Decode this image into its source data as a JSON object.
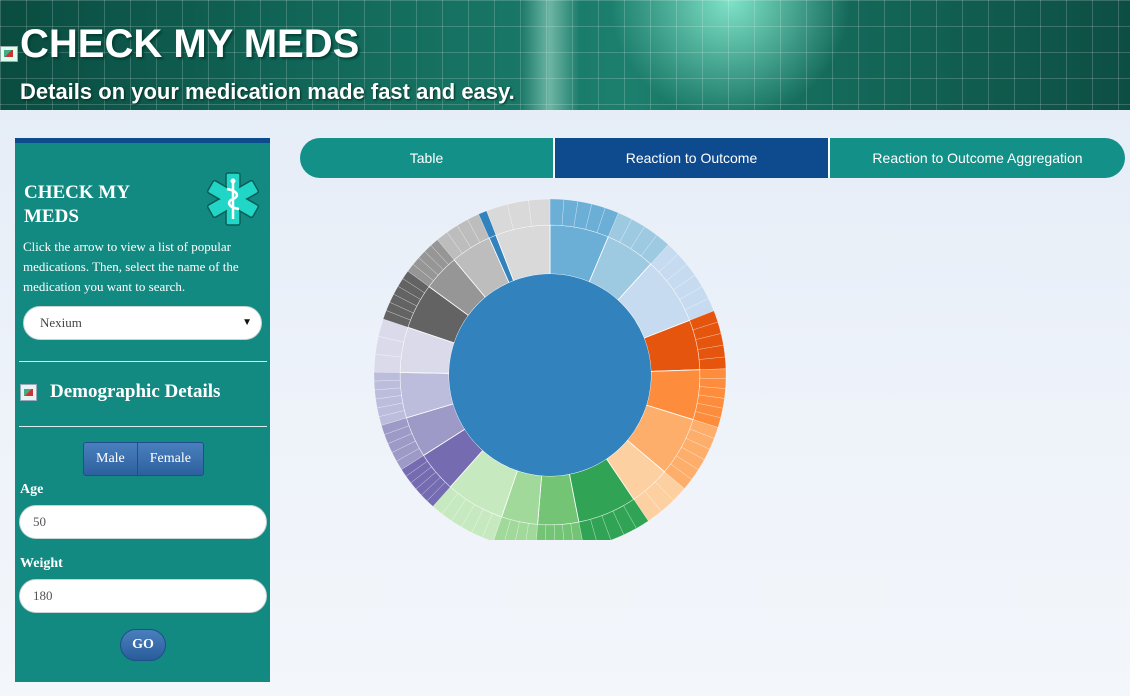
{
  "header": {
    "title": "CHECK MY MEDS",
    "tagline": "Details on your medication made fast and easy."
  },
  "sidebar": {
    "brand_title": "CHECK MY MEDS",
    "intro": "Click the arrow to view a list of popular medications. Then, select the name of the medication you want to search.",
    "medication_select": {
      "value": "Nexium"
    },
    "demographics_title": "Demographic Details",
    "gender_buttons": [
      "Male",
      "Female"
    ],
    "age": {
      "label": "Age",
      "value": "50"
    },
    "weight": {
      "label": "Weight",
      "value": "180"
    },
    "go_label": "GO"
  },
  "tabs": [
    "Table",
    "Reaction to Outcome",
    "Reaction to Outcome Aggregation"
  ],
  "colors": {
    "sidebar": "#128a82",
    "tab": "#139189",
    "tab_active": "#0e4a8e",
    "chart_center": "#3182bd"
  },
  "chart_data": {
    "type": "sunburst",
    "center_color": "#3182bd",
    "segments": [
      {
        "color": "#6baed6",
        "weight": 0.065,
        "sub": 5
      },
      {
        "color": "#9ecae1",
        "weight": 0.055,
        "sub": 4
      },
      {
        "color": "#c6dbef",
        "weight": 0.075,
        "sub": 6
      },
      {
        "color": "#e6550d",
        "weight": 0.055,
        "sub": 5
      },
      {
        "color": "#fd8d3c",
        "weight": 0.055,
        "sub": 6
      },
      {
        "color": "#fdae6b",
        "weight": 0.065,
        "sub": 6
      },
      {
        "color": "#fdd0a2",
        "weight": 0.045,
        "sub": 3
      },
      {
        "color": "#31a354",
        "weight": 0.065,
        "sub": 5
      },
      {
        "color": "#74c476",
        "weight": 0.045,
        "sub": 5
      },
      {
        "color": "#a1d99b",
        "weight": 0.04,
        "sub": 4
      },
      {
        "color": "#c7e9c0",
        "weight": 0.065,
        "sub": 6
      },
      {
        "color": "#756bb1",
        "weight": 0.045,
        "sub": 6
      },
      {
        "color": "#9e9ac8",
        "weight": 0.045,
        "sub": 5
      },
      {
        "color": "#bcbddc",
        "weight": 0.05,
        "sub": 6
      },
      {
        "color": "#dadaeb",
        "weight": 0.05,
        "sub": 3
      },
      {
        "color": "#636363",
        "weight": 0.05,
        "sub": 6
      },
      {
        "color": "#969696",
        "weight": 0.04,
        "sub": 5
      },
      {
        "color": "#bdbdbd",
        "weight": 0.045,
        "sub": 4
      },
      {
        "color": "#3182bd",
        "weight": 0.008,
        "sub": 1
      },
      {
        "color": "#d9d9d9",
        "weight": 0.06,
        "sub": 3
      }
    ]
  }
}
